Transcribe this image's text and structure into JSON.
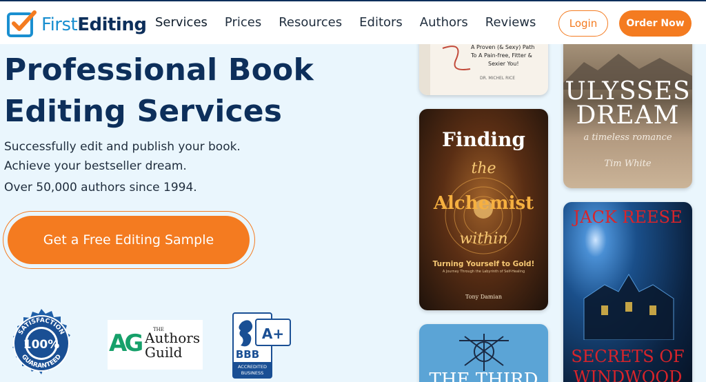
{
  "header": {
    "logo": {
      "first": "First",
      "editing": "Editing"
    },
    "nav": [
      "Services",
      "Prices",
      "Resources",
      "Editors",
      "Authors",
      "Reviews"
    ],
    "login_label": "Login",
    "order_label": "Order Now"
  },
  "hero": {
    "title_line1": "Professional Book",
    "title_line2": "Editing Services",
    "sub_line1": "Successfully edit and publish your book.",
    "sub_line2": "Achieve your bestseller dream.",
    "sub_line3": "Over 50,000 authors since 1994.",
    "cta_label": "Get a Free Editing Sample"
  },
  "badges": {
    "satisfaction": {
      "top": "SATISFACTION",
      "center": "100%",
      "bottom": "GUARANTEED"
    },
    "authors_guild": {
      "mark": "AG",
      "the": "THE",
      "line1": "Authors",
      "line2": "Guild"
    },
    "bbb": {
      "rating": "A+",
      "name": "BBB",
      "line1": "ACCREDITED",
      "line2": "BUSINESS"
    }
  },
  "books": {
    "book1": {
      "line1": "A Proven (& Sexy) Path",
      "line2": "To A Pain-free, Fitter &",
      "line3": "Sexier You!",
      "author": "DR. MICHEL RICE"
    },
    "book2": {
      "line1": "ULYSSES",
      "line2": "DREAM",
      "subtitle": "a timeless romance",
      "author": "Tim White"
    },
    "book3": {
      "line1": "Finding",
      "line2": "the",
      "line3": "Alchemist",
      "line4": "within",
      "subtitle": "Turning Yourself to Gold!",
      "tagline": "A Journey Through the Labyrinth of Self-Healing",
      "author": "Tony Damian"
    },
    "book4": {
      "author": "JACK REESE",
      "line1": "SECRETS OF",
      "line2": "WINDWOOD"
    },
    "book5": {
      "title": "THE THIRD"
    }
  },
  "colors": {
    "navy": "#0d2f5b",
    "orange": "#f47b20",
    "hero_bg": "#eaf6fd",
    "logo_blue": "#1a8fd0"
  }
}
